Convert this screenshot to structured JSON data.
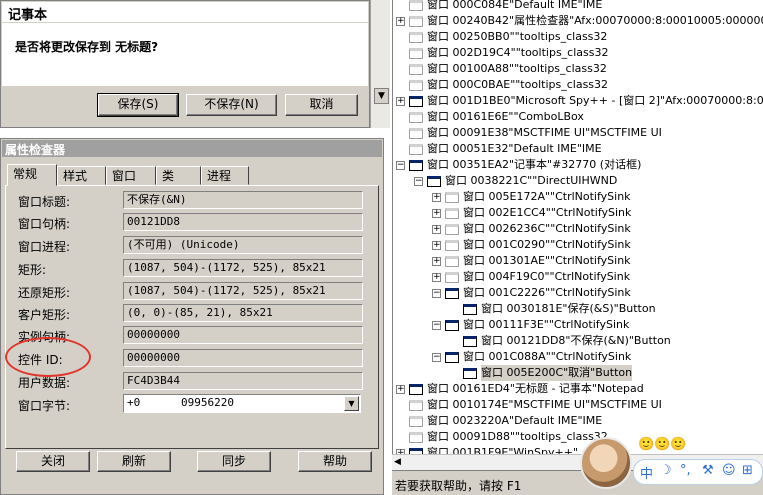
{
  "notepad_dialog": {
    "title": "记事本",
    "message": "是否将更改保存到 无标题?",
    "buttons": {
      "save": "保存(S)",
      "dont_save": "不保存(N)",
      "cancel": "取消"
    }
  },
  "inspector": {
    "title": "属性检查器",
    "tabs": [
      "常规",
      "样式",
      "窗口",
      "类",
      "进程"
    ],
    "fields": [
      {
        "label": "窗口标题:",
        "value": "不保存(&N)"
      },
      {
        "label": "窗口句柄:",
        "value": "00121DD8"
      },
      {
        "label": "窗口进程:",
        "value": "(不可用) (Unicode)"
      },
      {
        "label": "矩形:",
        "value": "(1087, 504)-(1172, 525), 85x21"
      },
      {
        "label": "还原矩形:",
        "value": "(1087, 504)-(1172, 525), 85x21"
      },
      {
        "label": "客户矩形:",
        "value": "(0, 0)-(85, 21), 85x21"
      },
      {
        "label": "实例句柄:",
        "value": "00000000"
      },
      {
        "label": "控件 ID:",
        "value": "00000000"
      },
      {
        "label": "用户数据:",
        "value": "FC4D3B44"
      }
    ],
    "bytes": {
      "label": "窗口字节:",
      "value1": "+0",
      "value2": "09956220"
    },
    "buttons": {
      "close": "关闭",
      "refresh": "刷新",
      "sync": "同步",
      "help": "帮助"
    }
  },
  "tree": {
    "nodes": [
      {
        "text": "窗口 000C084E\"Default IME\"IME",
        "expander": "",
        "indent": 0,
        "dim": true
      },
      {
        "text": "窗口 00240B42\"属性检查器\"Afx:00070000:8:00010005:000000",
        "expander": "+",
        "indent": 0,
        "dim": true
      },
      {
        "text": "窗口 00250BB0\"\"tooltips_class32",
        "expander": "",
        "indent": 0,
        "dim": true
      },
      {
        "text": "窗口 002D19C4\"\"tooltips_class32",
        "expander": "",
        "indent": 0,
        "dim": true
      },
      {
        "text": "窗口 00100A88\"\"tooltips_class32",
        "expander": "",
        "indent": 0,
        "dim": true
      },
      {
        "text": "窗口 000C0BAE\"\"tooltips_class32",
        "expander": "",
        "indent": 0,
        "dim": true
      },
      {
        "text": "窗口 001D1BE0\"Microsoft Spy++ - [窗口 2]\"Afx:00070000:8:000",
        "expander": "+",
        "indent": 0,
        "dim": false
      },
      {
        "text": "窗口 00161E6E\"\"ComboLBox",
        "expander": "",
        "indent": 0,
        "dim": true
      },
      {
        "text": "窗口 00091E38\"MSCTFIME UI\"MSCTFIME UI",
        "expander": "",
        "indent": 0,
        "dim": true
      },
      {
        "text": "窗口 00051E32\"Default IME\"IME",
        "expander": "",
        "indent": 0,
        "dim": true
      },
      {
        "text": "窗口 00351EA2\"记事本\"#32770 (对话框)",
        "expander": "-",
        "indent": 0,
        "dim": false
      },
      {
        "text": "窗口 0038221C\"\"DirectUIHWND",
        "expander": "-",
        "indent": 1,
        "dim": false
      },
      {
        "text": "窗口 005E172A\"\"CtrlNotifySink",
        "expander": "+",
        "indent": 2,
        "dim": true
      },
      {
        "text": "窗口 002E1CC4\"\"CtrlNotifySink",
        "expander": "+",
        "indent": 2,
        "dim": true
      },
      {
        "text": "窗口 0026236C\"\"CtrlNotifySink",
        "expander": "+",
        "indent": 2,
        "dim": true
      },
      {
        "text": "窗口 001C0290\"\"CtrlNotifySink",
        "expander": "+",
        "indent": 2,
        "dim": true
      },
      {
        "text": "窗口 001301AE\"\"CtrlNotifySink",
        "expander": "+",
        "indent": 2,
        "dim": true
      },
      {
        "text": "窗口 004F19C0\"\"CtrlNotifySink",
        "expander": "+",
        "indent": 2,
        "dim": true
      },
      {
        "text": "窗口 001C2226\"\"CtrlNotifySink",
        "expander": "-",
        "indent": 2,
        "dim": false
      },
      {
        "text": "窗口 0030181E\"保存(&S)\"Button",
        "expander": "",
        "indent": 3,
        "dim": false
      },
      {
        "text": "窗口 00111F3E\"\"CtrlNotifySink",
        "expander": "-",
        "indent": 2,
        "dim": false
      },
      {
        "text": "窗口 00121DD8\"不保存(&N)\"Button",
        "expander": "",
        "indent": 3,
        "dim": false
      },
      {
        "text": "窗口 001C088A\"\"CtrlNotifySink",
        "expander": "-",
        "indent": 2,
        "dim": false
      },
      {
        "text": "窗口 005E200C\"取消\"Button",
        "expander": "",
        "indent": 3,
        "dim": false,
        "selected": true
      },
      {
        "text": "窗口 00161ED4\"无标题 - 记事本\"Notepad",
        "expander": "+",
        "indent": 0,
        "dim": false
      },
      {
        "text": "窗口 0010174E\"MSCTFIME UI\"MSCTFIME UI",
        "expander": "",
        "indent": 0,
        "dim": true
      },
      {
        "text": "窗口 0023220A\"Default IME\"IME",
        "expander": "",
        "indent": 0,
        "dim": true
      },
      {
        "text": "窗口 00091D88\"\"tooltips_class32",
        "expander": "",
        "indent": 0,
        "dim": true
      },
      {
        "text": "窗口 001B1F9E\"WinSpy++\"",
        "expander": "+",
        "indent": 0,
        "dim": false
      }
    ]
  },
  "statusbar": {
    "text": "若要获取帮助，请按 F1"
  },
  "ime": {
    "lang": "中",
    "moon": "☽",
    "punct": "°,",
    "tool": "⚒",
    "emoji": "☺",
    "grid": "⊞"
  },
  "overlay": {
    "faces": "🙂🙂🙂"
  }
}
